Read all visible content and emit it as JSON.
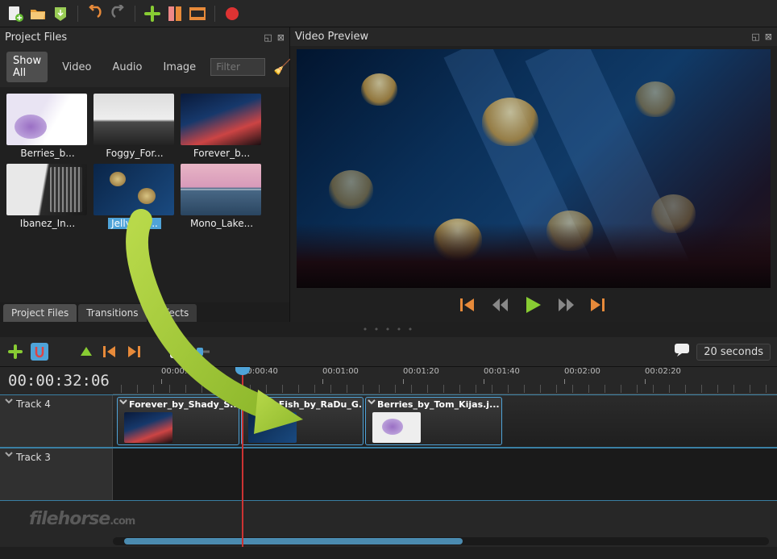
{
  "panels": {
    "project_files_title": "Project Files",
    "video_preview_title": "Video Preview"
  },
  "filter_tabs": {
    "show_all": "Show All",
    "video": "Video",
    "audio": "Audio",
    "image": "Image",
    "filter_placeholder": "Filter"
  },
  "thumbnails": [
    {
      "label": "Berries_b..."
    },
    {
      "label": "Foggy_For..."
    },
    {
      "label": "Forever_b..."
    },
    {
      "label": "Ibanez_In..."
    },
    {
      "label": "Jelly_Fis...",
      "selected": true
    },
    {
      "label": "Mono_Lake..."
    }
  ],
  "side_tabs": {
    "project_files": "Project Files",
    "transitions": "Transitions",
    "effects": "Effects"
  },
  "timeline": {
    "zoom_label": "20 seconds",
    "timecode": "00:00:32:06",
    "ruler_ticks": [
      "00:00:20",
      "00:00:40",
      "00:01:00",
      "00:01:20",
      "00:01:40",
      "00:02:00",
      "00:02:20"
    ],
    "tracks": [
      {
        "name": "Track 4"
      },
      {
        "name": "Track 3"
      }
    ],
    "clips": [
      {
        "title": "Forever_by_Shady_S..."
      },
      {
        "title": "Jelly_Fish_by_RaDu_G..."
      },
      {
        "title": "Berries_by_Tom_Kijas.j..."
      }
    ]
  },
  "watermark": {
    "main": "filehorse",
    "suffix": ".com"
  }
}
